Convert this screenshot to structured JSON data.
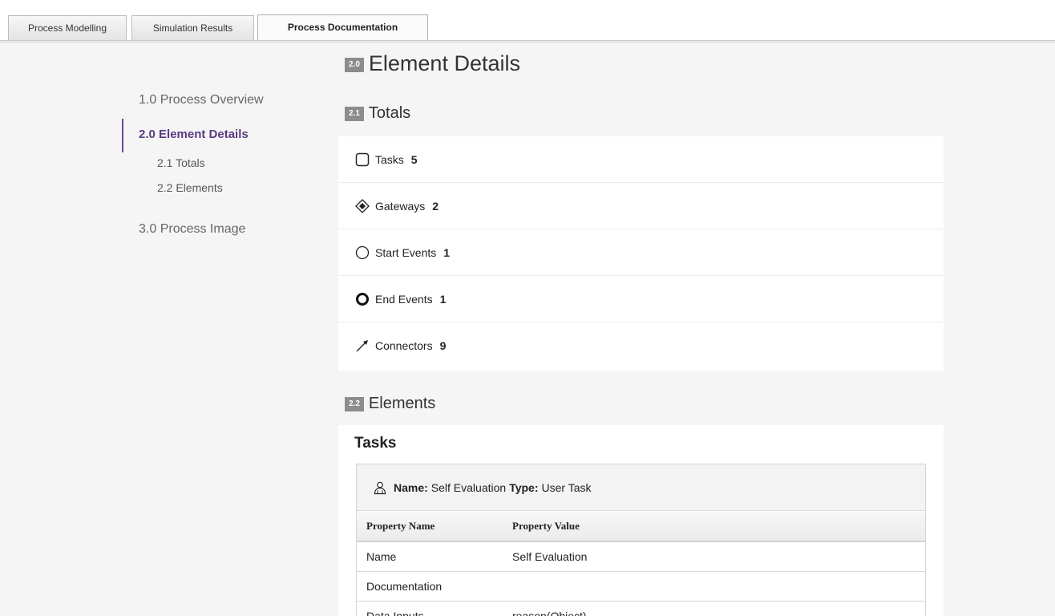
{
  "tabs": [
    {
      "label": "Process Modelling"
    },
    {
      "label": "Simulation Results"
    },
    {
      "label": "Process Documentation"
    }
  ],
  "nav": {
    "items": [
      {
        "label": "1.0 Process Overview"
      },
      {
        "label": "2.0 Element Details"
      },
      {
        "label": "2.1 Totals"
      },
      {
        "label": "2.2 Elements"
      },
      {
        "label": "3.0 Process Image"
      }
    ],
    "active_item": "2.0 Element Details"
  },
  "sections": {
    "element_details": {
      "badge": "2.0",
      "title": "Element Details"
    },
    "totals": {
      "badge": "2.1",
      "title": "Totals"
    },
    "elements": {
      "badge": "2.2",
      "title": "Elements"
    }
  },
  "totals": [
    {
      "label": "Tasks",
      "count": "5",
      "icon": "task-icon"
    },
    {
      "label": "Gateways",
      "count": "2",
      "icon": "gateway-icon"
    },
    {
      "label": "Start Events",
      "count": "1",
      "icon": "start-event-icon"
    },
    {
      "label": "End Events",
      "count": "1",
      "icon": "end-event-icon"
    },
    {
      "label": "Connectors",
      "count": "9",
      "icon": "connector-icon"
    }
  ],
  "elements": {
    "heading": "Tasks",
    "task": {
      "icon": "user-task-icon",
      "name_label": "Name:",
      "name_value": "Self Evaluation",
      "type_label": "Type:",
      "type_value": "User Task",
      "columns": [
        "Property Name",
        "Property Value"
      ],
      "rows": [
        [
          "Name",
          "Self Evaluation"
        ],
        [
          "Documentation",
          ""
        ],
        [
          "Data Inputs",
          "reason(Object)"
        ]
      ]
    }
  },
  "colors": {
    "accent": "#6a4a94",
    "badge": "#8c8c8c",
    "background": "#f5f5f5"
  }
}
